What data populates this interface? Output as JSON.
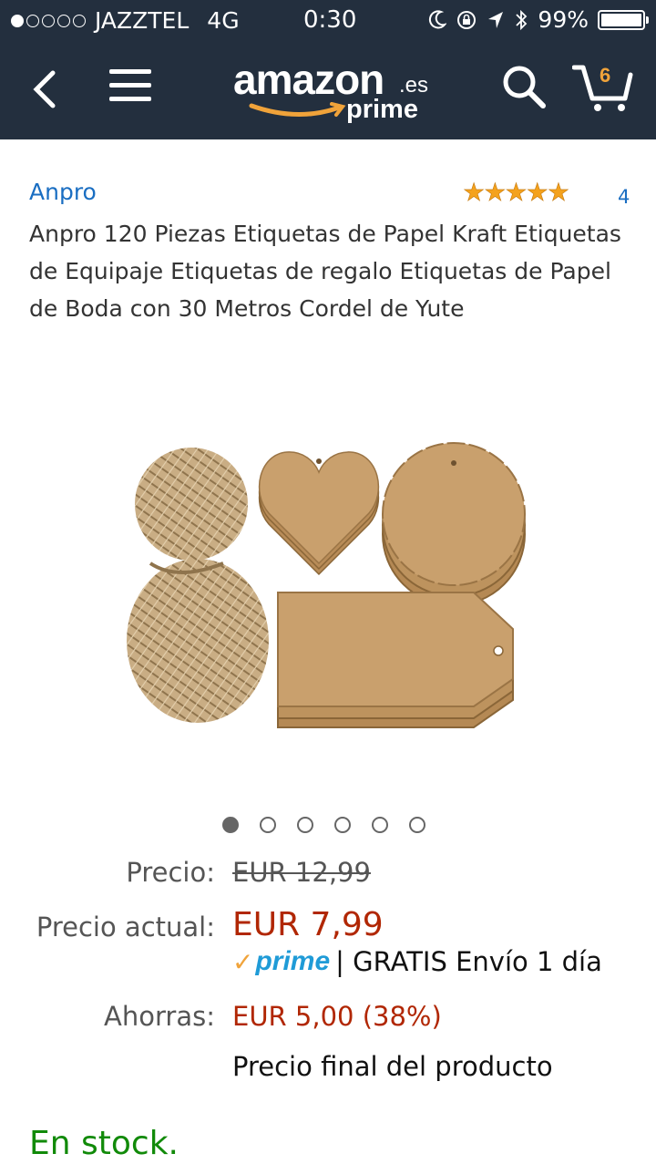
{
  "status_bar": {
    "carrier": "JAZZTEL",
    "network": "4G",
    "time": "0:30",
    "battery": "99%",
    "battery_level": 0.99,
    "signal_bars": 1
  },
  "nav": {
    "logo_text": "amazon",
    "logo_domain": ".es",
    "logo_sub": "prime",
    "cart_count": "6"
  },
  "product": {
    "brand": "Anpro",
    "rating_stars": "★★★★★",
    "review_count": "4",
    "title": "Anpro 120 Piezas Etiquetas de Papel Kraft Etiquetas de Equipaje Etiquetas de regalo Etiquetas de Papel de Boda con 30 Metros Cordel de Yute"
  },
  "gallery": {
    "total_images": 6,
    "active_index": 0
  },
  "pricing": {
    "list_label": "Precio:",
    "list_price": "EUR 12,99",
    "deal_label": "Precio actual:",
    "deal_price": "EUR 7,99",
    "prime_word": "prime",
    "shipping_text": "| GRATIS Envío 1 día",
    "savings_label": "Ahorras:",
    "savings_value": "EUR 5,00 (38%)",
    "final_note": "Precio final del producto"
  },
  "availability": "En stock.",
  "colors": {
    "header_bg": "#232f3e",
    "link_blue": "#1a6ec2",
    "price_red": "#b12704",
    "stock_green": "#118a09",
    "star_orange": "#f4a21d",
    "prime_blue": "#1f9bd7"
  }
}
